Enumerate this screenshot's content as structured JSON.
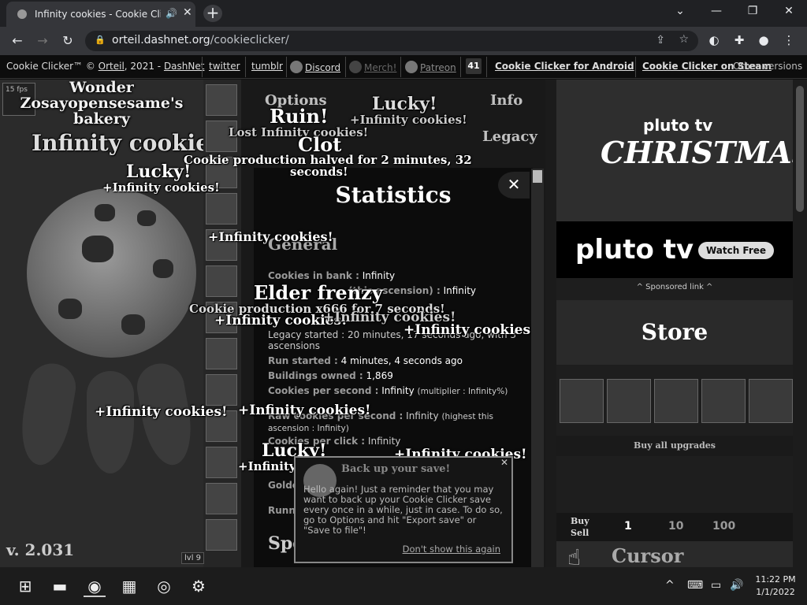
{
  "browser": {
    "tab_title": "Infinity cookies - Cookie Click",
    "url_host": "orteil.dashnet.org",
    "url_path": "/cookieclicker/"
  },
  "topbar": {
    "copyright": "Cookie Clicker™ © ",
    "orteil": "Orteil",
    "year": ", 2021 - ",
    "dashnet": "DashNet",
    "twitter": "twitter",
    "tumblr": "tumblr",
    "discord": "Discord",
    "merch": "Merch!",
    "patreon": "Patreon",
    "badge": "41",
    "android": "Cookie Clicker for Android",
    "steam": "Cookie Clicker on Steam",
    "versions": "Other versions"
  },
  "game": {
    "fps": "15 fps",
    "bakery_line1": "Wonder",
    "bakery_line2": "Zosayopensesame's",
    "bakery_line3": "bakery",
    "cookies_count": "Infinity cookies",
    "version": "v. 2.031",
    "level_badge": "lvl 9",
    "menu_options": "Options",
    "menu_info": "Info",
    "menu_legacy": "Legacy"
  },
  "stats": {
    "title": "Statistics",
    "section": "General",
    "bank_label": "Cookies in bank :",
    "bank_value": "Infinity",
    "ascension_label": "(this ascension) :",
    "ascension_value": "Infinity",
    "legacy_line": "Legacy started : 20 minutes, 17 seconds ago, with 3",
    "legacy_line2": "ascensions",
    "run_label": "Run started :",
    "run_value": "4 minutes, 4 seconds ago",
    "buildings_label": "Buildings owned :",
    "buildings_value": "1,869",
    "cps_label": "Cookies per second :",
    "cps_value": "Infinity",
    "cps_mult": "(multiplier : Infinity%)",
    "raw_label": "Raw cookies per second :",
    "raw_value": "Infinity",
    "raw_note": "(highest this ascension : Infinity)",
    "click_label": "Cookies per click :",
    "click_value": "Infinity",
    "golden_label": "Golde",
    "runn_label": "Runn",
    "special_label": "Spe"
  },
  "popup": {
    "title": "Back up your save!",
    "body": "Hello again! Just a reminder that you may want to back up your Cookie Clicker save every once in a while, just in case. To do so, go to Options and hit \"Export save\" or \"Save to file\"!",
    "dont_show": "Don't show this again"
  },
  "floaters": {
    "wonder_title": "Wonder",
    "lucky1": "Lucky!",
    "lucky2": "Lucky!",
    "lucky3": "Lucky!",
    "infinity": "+Infinity cookies!",
    "ruin": "Ruin!",
    "lost": "Lost Infinity cookies!",
    "clot": "Clot",
    "clot_desc": "Cookie production halved for 2 minutes, 32",
    "clot_desc2": "seconds!",
    "frenzy": "Elder frenzy",
    "frenzy_desc": "Cookie production x666 for 7 seconds!"
  },
  "store": {
    "ad_brand": "pluto tv",
    "ad_xmas": "CHRISTMAS",
    "ad_brand2": "pluto tv",
    "ad_watch": "Watch Free",
    "sponsored": "^ Sponsored link ^",
    "title": "Store",
    "buy_all": "Buy all upgrades",
    "buy": "Buy",
    "sell": "Sell",
    "q1": "1",
    "q10": "10",
    "q100": "100",
    "cursor": "Cursor"
  },
  "taskbar": {
    "time": "11:22 PM",
    "date": "1/1/2022"
  },
  "colors": {
    "chrome_bg": "#202124",
    "game_bg": "#1b1b1b",
    "text": "#ffffff"
  }
}
